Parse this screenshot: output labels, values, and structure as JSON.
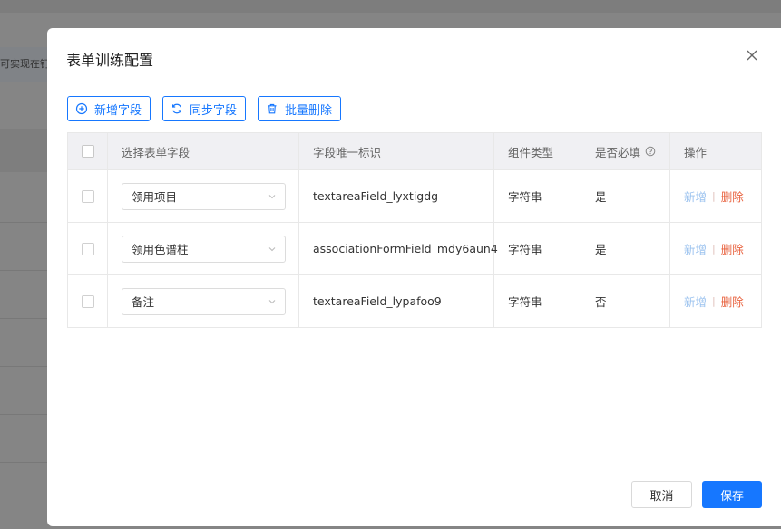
{
  "background": {
    "notice_text": "可实现在钉钉"
  },
  "modal": {
    "title": "表单训练配置",
    "close_icon": "close-icon"
  },
  "toolbar": {
    "add_field_label": "新增字段",
    "add_field_icon": "plus-circle-icon",
    "sync_field_label": "同步字段",
    "sync_field_icon": "sync-icon",
    "batch_delete_label": "批量删除",
    "batch_delete_icon": "trash-icon"
  },
  "table": {
    "columns": [
      "选择表单字段",
      "字段唯一标识",
      "组件类型",
      "是否必填",
      "操作"
    ],
    "rows": [
      {
        "field": "领用项目",
        "key": "textareaField_lyxtigdg",
        "type": "字符串",
        "required": "是",
        "action_add": "新增",
        "action_delete": "删除"
      },
      {
        "field": "领用色谱柱",
        "key": "associationFormField_mdy6aun4",
        "type": "字符串",
        "required": "是",
        "action_add": "新增",
        "action_delete": "删除"
      },
      {
        "field": "备注",
        "key": "textareaField_lypafoo9",
        "type": "字符串",
        "required": "否",
        "action_add": "新增",
        "action_delete": "删除"
      }
    ],
    "action_separator": "|"
  },
  "footer": {
    "cancel_label": "取消",
    "save_label": "保存"
  },
  "colors": {
    "primary": "#1677ff",
    "danger": "#e8603c",
    "disabled_link": "#9cc3ef"
  }
}
